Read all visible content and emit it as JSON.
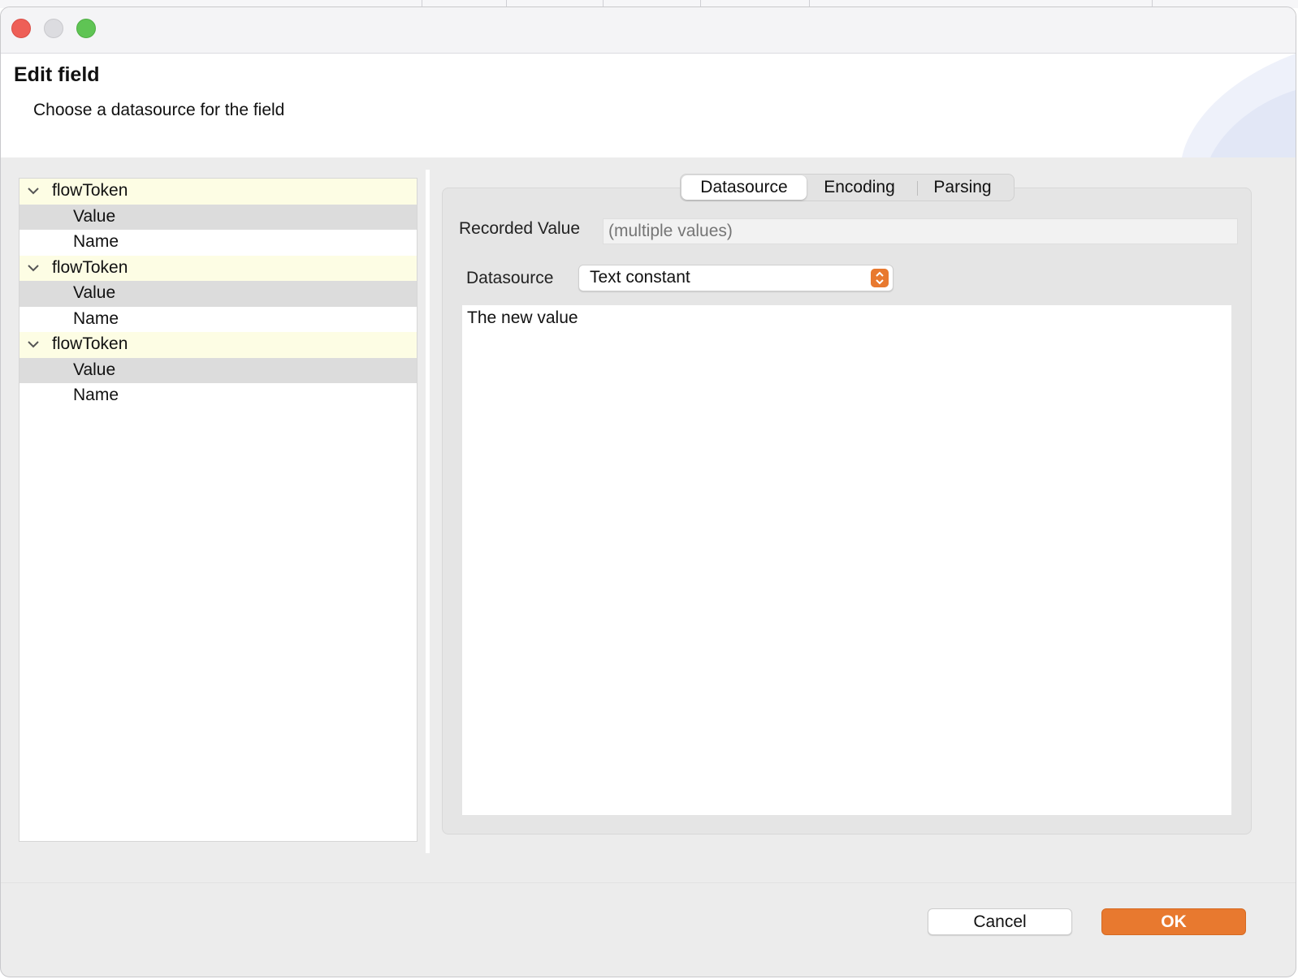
{
  "dialog": {
    "title": "Edit field",
    "subtitle": "Choose a datasource for the field"
  },
  "tree": {
    "groups": [
      {
        "label": "flowToken",
        "children": [
          {
            "label": "Value",
            "selected": true
          },
          {
            "label": "Name",
            "selected": false
          }
        ]
      },
      {
        "label": "flowToken",
        "children": [
          {
            "label": "Value",
            "selected": true
          },
          {
            "label": "Name",
            "selected": false
          }
        ]
      },
      {
        "label": "flowToken",
        "children": [
          {
            "label": "Value",
            "selected": true
          },
          {
            "label": "Name",
            "selected": false
          }
        ]
      }
    ]
  },
  "tabs": {
    "datasource": "Datasource",
    "encoding": "Encoding",
    "parsing": "Parsing",
    "active": "Datasource"
  },
  "form": {
    "recorded_value_label": "Recorded Value",
    "recorded_value_placeholder": "(multiple values)",
    "datasource_label": "Datasource",
    "datasource_selected": "Text constant",
    "text_value": "The new value"
  },
  "buttons": {
    "cancel": "Cancel",
    "ok": "OK"
  },
  "colors": {
    "accent": "#e8792f",
    "tree_group_bg": "#fdfde4",
    "tree_selected_bg": "#dcdcdc"
  },
  "icons": {
    "window_close": "close-icon",
    "window_minimize": "minimize-icon",
    "window_maximize": "maximize-icon",
    "tree_expand": "chevron-down-icon",
    "select_arrows": "chevron-up-down-icon"
  }
}
